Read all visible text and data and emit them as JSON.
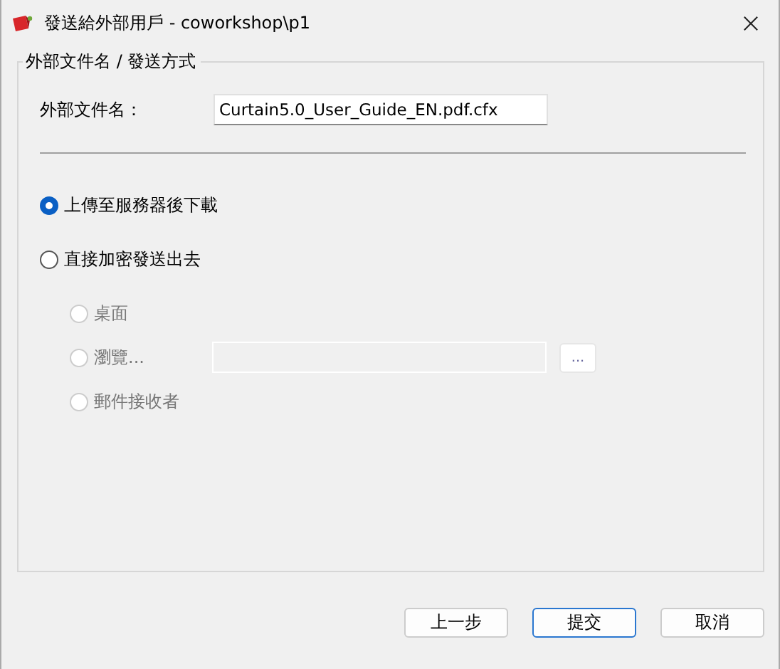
{
  "window": {
    "title": "發送給外部用戶 - coworkshop\\p1"
  },
  "group": {
    "legend": "外部文件名 / 發送方式",
    "filename": {
      "label": "外部文件名：",
      "value": "Curtain5.0_User_Guide_EN.pdf.cfx"
    },
    "options": [
      {
        "label": "上傳至服務器後下載",
        "selected": true,
        "disabled": false
      },
      {
        "label": "直接加密發送出去",
        "selected": false,
        "disabled": false,
        "children": [
          {
            "label": "桌面",
            "selected": false,
            "disabled": true,
            "kind": "plain"
          },
          {
            "label": "瀏覽...",
            "selected": false,
            "disabled": true,
            "kind": "path",
            "browse_button": "..."
          },
          {
            "label": "郵件接收者",
            "selected": false,
            "disabled": true,
            "kind": "plain"
          }
        ]
      }
    ]
  },
  "buttons": [
    {
      "label": "上一步",
      "default": false
    },
    {
      "label": "提交",
      "default": true
    },
    {
      "label": "取消",
      "default": false
    }
  ]
}
